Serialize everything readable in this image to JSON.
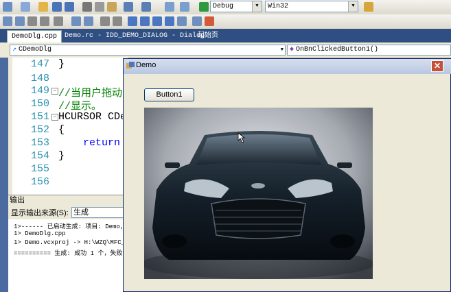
{
  "toolbar": {
    "configuration": "Debug",
    "platform": "Win32"
  },
  "tabs": [
    {
      "label": "DemoDlg.cpp",
      "active": true
    },
    {
      "label": "Demo.rc - IDD_DEMO_DIALOG - Dialog",
      "active": false
    },
    {
      "label": "起始页",
      "active": false
    }
  ],
  "navbar": {
    "class_combo": "CDemoDlg",
    "member_combo": "OnBnClickedButton1()"
  },
  "editor": {
    "lines": [
      {
        "num": "147",
        "code": "}"
      },
      {
        "num": "148",
        "code": ""
      },
      {
        "num": "149",
        "code": "//当用户拖动"
      },
      {
        "num": "150",
        "code": "//显示。"
      },
      {
        "num": "151",
        "code": "HCURSOR CDem"
      },
      {
        "num": "152",
        "code": "{"
      },
      {
        "num": "153",
        "code": "    return"
      },
      {
        "num": "154",
        "code": "}"
      },
      {
        "num": "155",
        "code": ""
      },
      {
        "num": "156",
        "code": ""
      }
    ]
  },
  "output": {
    "title": "输出",
    "source_label": "显示输出来源(S):",
    "source_value": "生成",
    "lines": [
      "1>------ 已启动生成: 项目: Demo,",
      "1>  DemoDlg.cpp",
      "1>  Demo.vcxproj -> H:\\WZQ\\MFC_",
      "========== 生成: 成功 1 个，失败"
    ]
  },
  "dialog": {
    "title": "Demo",
    "close": "✕",
    "button_label": "Button1"
  },
  "colors": {
    "titlebar": "#b8c7e0",
    "close_button": "#c2513b",
    "comment": "#008000",
    "keyword": "#0000ff",
    "line_number": "#2b91af"
  }
}
